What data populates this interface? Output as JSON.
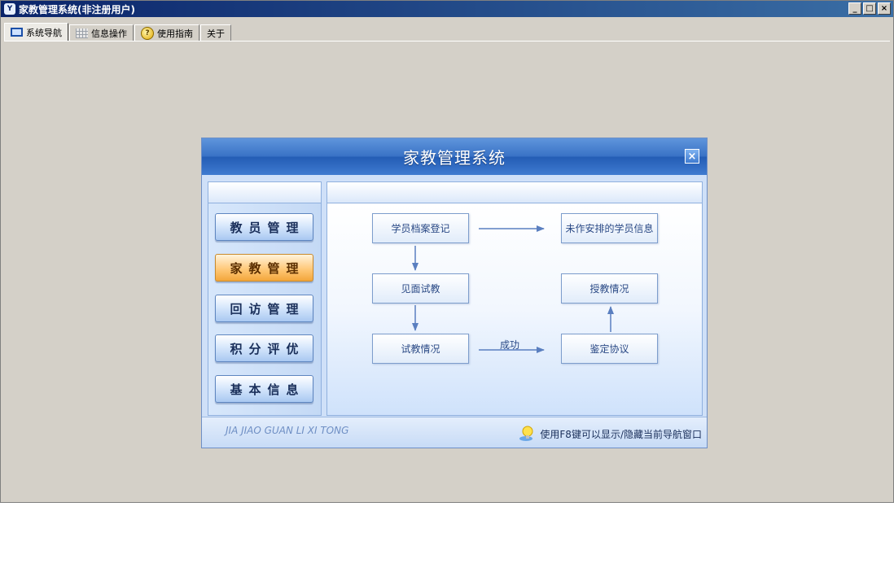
{
  "window": {
    "title": "家教管理系统(非注册用户)",
    "controls": [
      "_",
      "□",
      "×"
    ]
  },
  "tabs": [
    {
      "label": "系统导航",
      "icon": "monitor-icon",
      "active": true
    },
    {
      "label": "信息操作",
      "icon": "grid-icon",
      "active": false
    },
    {
      "label": "使用指南",
      "icon": "help-icon",
      "active": false
    },
    {
      "label": "关于",
      "icon": "",
      "active": false
    }
  ],
  "nav": {
    "title": "家教管理系统",
    "close_label": "×",
    "buttons": [
      {
        "label": "教员管理",
        "active": false
      },
      {
        "label": "家教管理",
        "active": true
      },
      {
        "label": "回访管理",
        "active": false
      },
      {
        "label": "积分评优",
        "active": false
      },
      {
        "label": "基本信息",
        "active": false
      }
    ],
    "flow": {
      "step1": "学员档案登记",
      "step2": "见面试教",
      "step3": "试教情况",
      "step4": "鉴定协议",
      "step5": "授教情况",
      "step6": "未作安排的学员信息",
      "edge_label": "成功"
    },
    "footer": {
      "brand": "JIA JIAO GUAN LI XI TONG",
      "tip": "使用F8键可以显示/隐藏当前导航窗口"
    }
  },
  "colors": {
    "titlebar": "#0a246a",
    "header": "#3a73c6",
    "active_button": "#f3a63b",
    "arrow": "#5a7fc0"
  }
}
